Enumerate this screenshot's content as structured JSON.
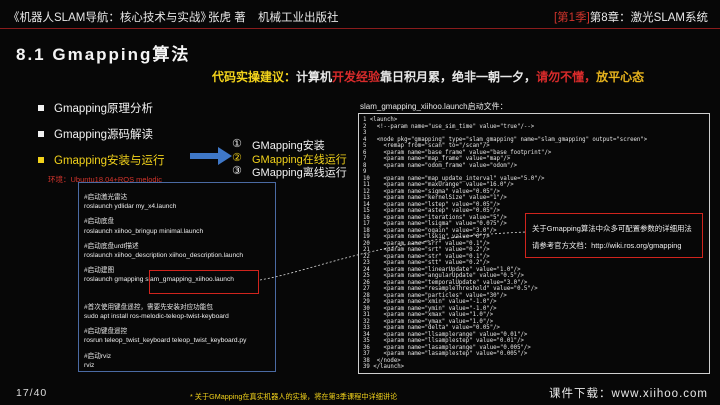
{
  "header": {
    "book": "《机器人SLAM导航：核心技术与实战》",
    "author": "张虎 著",
    "publisher": "机械工业出版社",
    "season": "[第1季]",
    "chapter": "第8章：激光SLAM系统"
  },
  "title": "8.1 Gmapping算法",
  "advice": {
    "label": "代码实操建议：",
    "part1": "计算机",
    "part2": "开发经验",
    "part3": "靠日积月累，绝非一朝一夕，",
    "part4": "请勿不懂，",
    "part5": "放平心态"
  },
  "bullets": [
    {
      "label": "Gmapping原理分析"
    },
    {
      "label": "Gmapping源码解读"
    },
    {
      "label": "Gmapping安装与运行"
    }
  ],
  "environment": "环境：Ubuntu18.04+ROS melodic",
  "numbered_list": [
    {
      "num": "①",
      "label": "GMapping安装"
    },
    {
      "num": "②",
      "label": "GMapping在线运行"
    },
    {
      "num": "③",
      "label": "GMapping离线运行"
    }
  ],
  "launch_title": "slam_gmapping_xiihoo.launch启动文件：",
  "commands": [
    {
      "text": "#启动激光雷达",
      "comment": true
    },
    {
      "text": "roslaunch ydlidar my_x4.launch",
      "comment": false
    },
    {
      "text": "#启动底盘",
      "comment": true
    },
    {
      "text": "roslaunch xiihoo_bringup minimal.launch",
      "comment": false
    },
    {
      "text": "#启动底盘urdf描述",
      "comment": true
    },
    {
      "text": "roslaunch xiihoo_description xiihoo_description.launch",
      "comment": false
    },
    {
      "text": "#启动建图",
      "comment": true
    },
    {
      "text": "roslaunch gmapping slam_gmapping_xiihoo.launch",
      "comment": false
    },
    {
      "text": "",
      "comment": false
    },
    {
      "text": "#首次使用键盘遥控，需要先安装对应功能包",
      "comment": true
    },
    {
      "text": "sudo apt install ros-melodic-teleop-twist-keyboard",
      "comment": false
    },
    {
      "text": "#启动键盘遥控",
      "comment": true
    },
    {
      "text": "rosrun teleop_twist_keyboard teleop_twist_keyboard.py",
      "comment": false
    },
    {
      "text": "#启动rviz",
      "comment": true
    },
    {
      "text": "rviz",
      "comment": false
    }
  ],
  "code_lines": [
    "1 <launch>",
    "2   <!--param name=\"use_sim_time\" value=\"true\"/-->",
    "3",
    "4   <node pkg=\"gmapping\" type=\"slam_gmapping\" name=\"slam_gmapping\" output=\"screen\">",
    "5     <remap from=\"scan\" to=\"/scan\"/>",
    "6     <param name=\"base_frame\" value=\"base_footprint\"/>",
    "7     <param name=\"map_frame\" value=\"map\"/>",
    "8     <param name=\"odom_frame\" value=\"odom\"/>",
    "9",
    "10    <param name=\"map_update_interval\" value=\"5.0\"/>",
    "11    <param name=\"maxUrange\" value=\"16.0\"/>",
    "12    <param name=\"sigma\" value=\"0.05\"/>",
    "13    <param name=\"kernelSize\" value=\"1\"/>",
    "14    <param name=\"lstep\" value=\"0.05\"/>",
    "15    <param name=\"astep\" value=\"0.05\"/>",
    "16    <param name=\"iterations\" value=\"5\"/>",
    "17    <param name=\"lsigma\" value=\"0.075\"/>",
    "18    <param name=\"ogain\" value=\"3.0\"/>",
    "19    <param name=\"lskip\" value=\"0\"/>",
    "20    <param name=\"srr\" value=\"0.1\"/>",
    "21    <param name=\"srt\" value=\"0.2\"/>",
    "22    <param name=\"str\" value=\"0.1\"/>",
    "23    <param name=\"stt\" value=\"0.2\"/>",
    "24    <param name=\"linearUpdate\" value=\"1.0\"/>",
    "25    <param name=\"angularUpdate\" value=\"0.5\"/>",
    "26    <param name=\"temporalUpdate\" value=\"3.0\"/>",
    "27    <param name=\"resampleThreshold\" value=\"0.5\"/>",
    "28    <param name=\"particles\" value=\"30\"/>",
    "29    <param name=\"xmin\" value=\"-1.0\"/>",
    "30    <param name=\"ymin\" value=\"-1.0\"/>",
    "31    <param name=\"xmax\" value=\"1.0\"/>",
    "32    <param name=\"ymax\" value=\"1.0\"/>",
    "33    <param name=\"delta\" value=\"0.05\"/>",
    "34    <param name=\"llsamplerange\" value=\"0.01\"/>",
    "35    <param name=\"llsamplestep\" value=\"0.01\"/>",
    "36    <param name=\"lasamplerange\" value=\"0.005\"/>",
    "37    <param name=\"lasamplestep\" value=\"0.005\"/>",
    "38  </node>",
    "39 </launch>"
  ],
  "note": {
    "line1": "关于Gmapping算法中众多可配置参数的详细用法",
    "line2": "请参考官方文档：http://wiki.ros.org/gmapping"
  },
  "footer_note": "* 关于GMapping在真实机器人的实操，将在第3季课程中详细讲论",
  "page_number": "17/40",
  "download": "课件下载：www.xiihoo.com",
  "colors": {
    "accent_red": "#d0241d",
    "accent_yellow": "#f2d21b",
    "box_blue": "#4a6aa3",
    "arrow_blue": "#3f78c8"
  }
}
